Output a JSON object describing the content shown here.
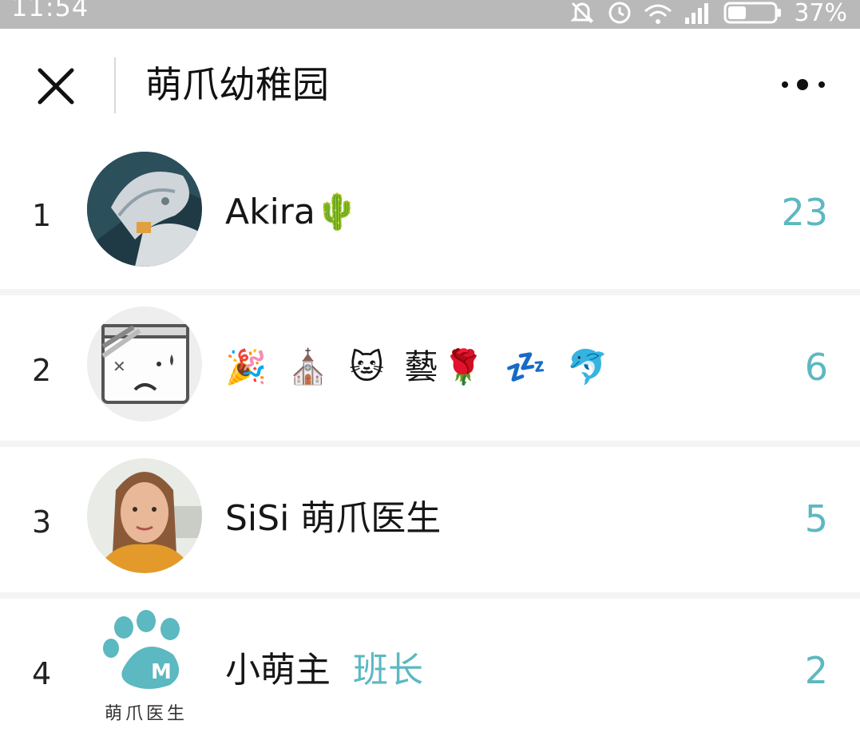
{
  "statusbar": {
    "time": "11:54",
    "battery_pct": "37%",
    "icons": [
      "muted-bell-icon",
      "alarm-icon",
      "wifi-icon",
      "signal-icon",
      "battery-icon"
    ]
  },
  "navbar": {
    "title": "萌爪幼稚园",
    "close_icon": "close-icon",
    "more_icon": "more-icon"
  },
  "rows": [
    {
      "rank": "1",
      "name": "Akira🌵",
      "tag": "",
      "score": "23"
    },
    {
      "rank": "2",
      "name": "🎉 ⛪ 🐱 藝🌹 💤 🐬",
      "tag": "",
      "score": "6"
    },
    {
      "rank": "3",
      "name": "SiSi 萌爪医生",
      "tag": "",
      "score": "5"
    },
    {
      "rank": "4",
      "name": "小萌主",
      "tag": "班长",
      "score": "2"
    }
  ],
  "avatar4_caption": "萌爪医生",
  "colors": {
    "accent": "#5cb8c1",
    "statusbar_bg": "#b9b9b9"
  }
}
